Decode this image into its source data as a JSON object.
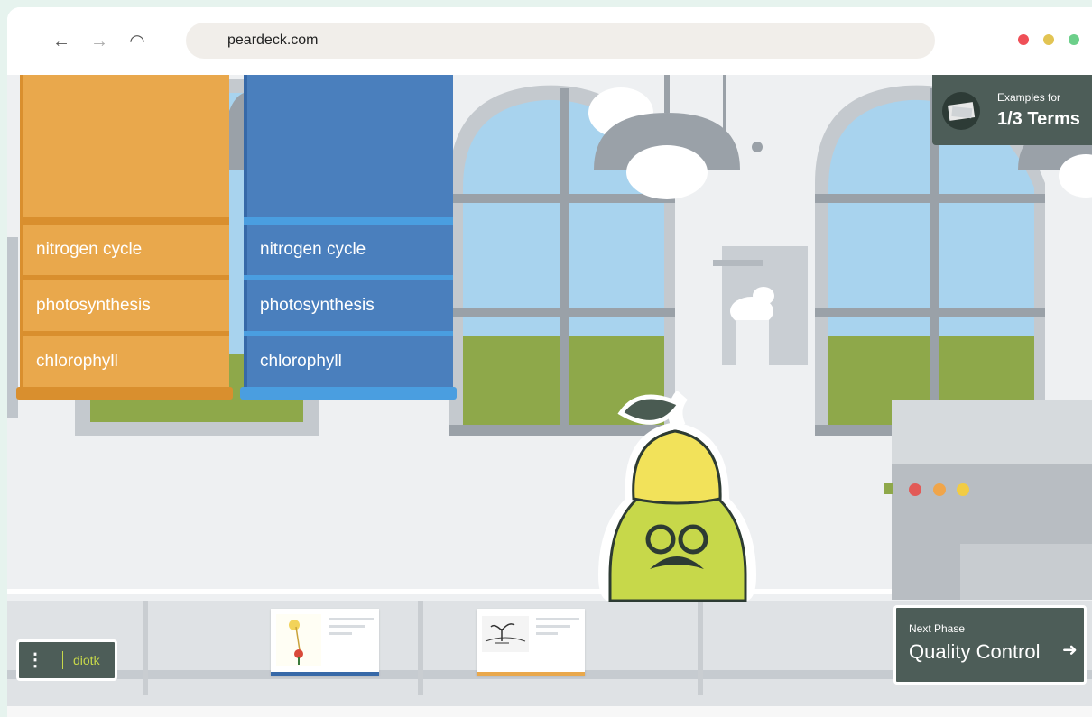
{
  "browser": {
    "url": "peardeck.com",
    "nav": {
      "back": "←",
      "forward": "→",
      "reload": "◠"
    },
    "dots": [
      "#ef4f57",
      "#e2c453",
      "#6ccf8a"
    ]
  },
  "columns": [
    {
      "color": "#e9a84c",
      "band": "#d98f2e",
      "terms": [
        "nitrogen cycle",
        "photosynthesis",
        "chlorophyll"
      ]
    },
    {
      "color": "#4a7fbd",
      "band": "#4a9ee0",
      "terms": [
        "nitrogen cycle",
        "photosynthesis",
        "chlorophyll"
      ]
    }
  ],
  "examples_badge": {
    "label": "Examples for",
    "value": "1/3 Terms"
  },
  "machine": {
    "lights": [
      "#e25a57",
      "#f0a54a",
      "#f2cc44"
    ]
  },
  "footer": {
    "menu_icon": "⋮",
    "username": "diotk",
    "next_phase": {
      "label": "Next Phase",
      "title": "Quality Control",
      "arrow": "➜"
    }
  }
}
